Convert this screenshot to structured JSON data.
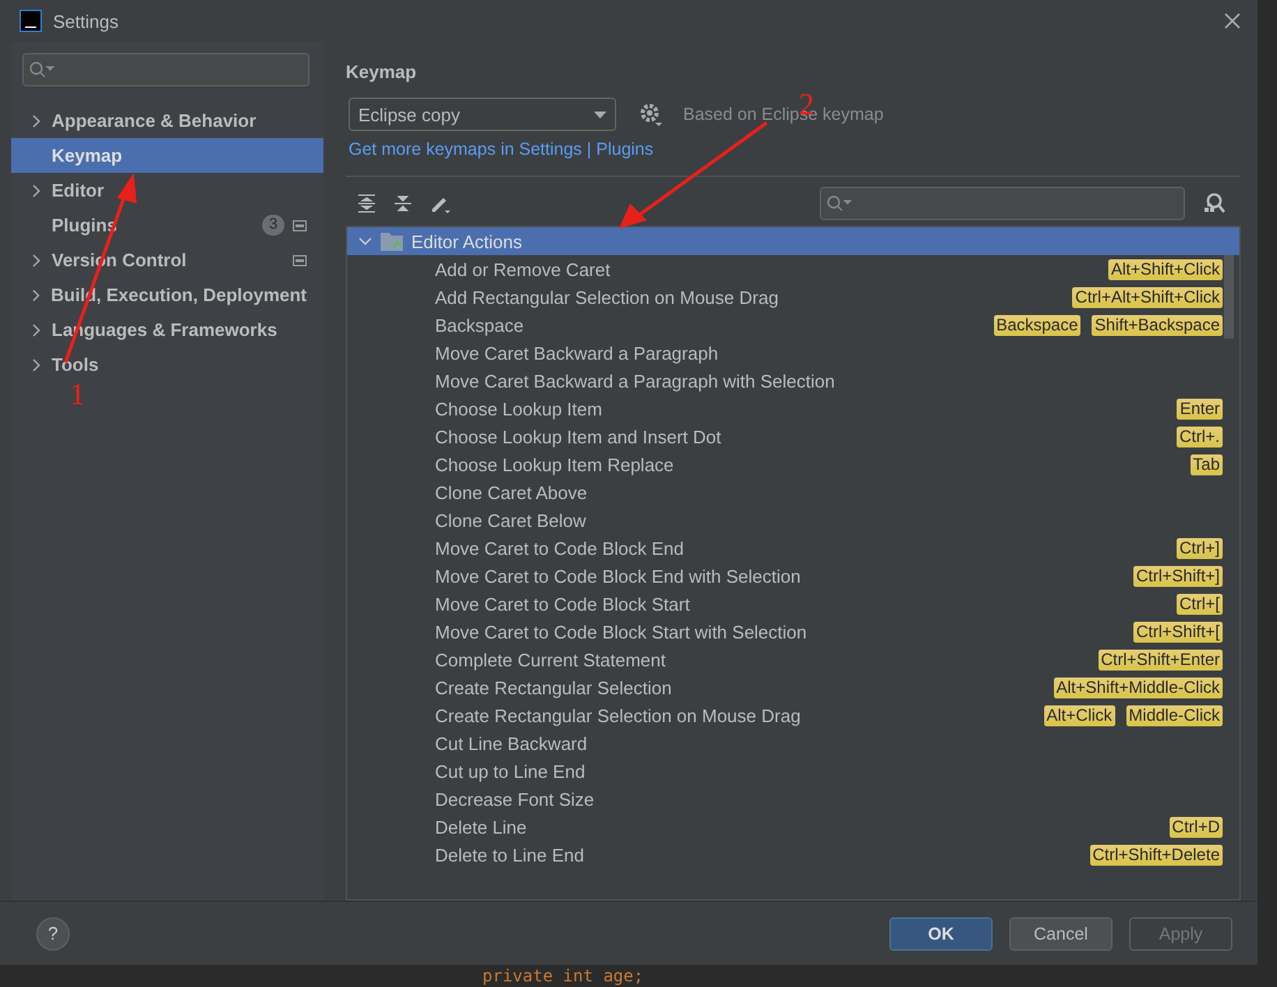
{
  "window": {
    "title": "Settings"
  },
  "sidebar": {
    "items": [
      {
        "label": "Appearance & Behavior",
        "expandable": true,
        "selected": false
      },
      {
        "label": "Keymap",
        "expandable": false,
        "selected": true
      },
      {
        "label": "Editor",
        "expandable": true,
        "selected": false
      },
      {
        "label": "Plugins",
        "expandable": false,
        "selected": false,
        "badge": "3",
        "project_icon": true
      },
      {
        "label": "Version Control",
        "expandable": true,
        "selected": false,
        "project_icon": true
      },
      {
        "label": "Build, Execution, Deployment",
        "expandable": true,
        "selected": false
      },
      {
        "label": "Languages & Frameworks",
        "expandable": true,
        "selected": false
      },
      {
        "label": "Tools",
        "expandable": true,
        "selected": false
      }
    ]
  },
  "panel": {
    "title": "Keymap",
    "keymap": "Eclipse copy",
    "based_on": "Based on Eclipse keymap",
    "link": "Get more keymaps in Settings | Plugins",
    "tree": [
      {
        "label": "Editor Actions",
        "expanded": true,
        "selected": true,
        "children": [
          {
            "label": "Add or Remove Caret",
            "shortcuts": [
              "Alt+Shift+Click"
            ]
          },
          {
            "label": "Add Rectangular Selection on Mouse Drag",
            "shortcuts": [
              "Ctrl+Alt+Shift+Click"
            ]
          },
          {
            "label": "Backspace",
            "shortcuts": [
              "Backspace",
              "Shift+Backspace"
            ]
          },
          {
            "label": "Move Caret Backward a Paragraph"
          },
          {
            "label": "Move Caret Backward a Paragraph with Selection"
          },
          {
            "label": "Choose Lookup Item",
            "shortcuts": [
              "Enter"
            ]
          },
          {
            "label": "Choose Lookup Item and Insert Dot",
            "shortcuts": [
              "Ctrl+."
            ]
          },
          {
            "label": "Choose Lookup Item Replace",
            "shortcuts": [
              "Tab"
            ]
          },
          {
            "label": "Clone Caret Above"
          },
          {
            "label": "Clone Caret Below"
          },
          {
            "label": "Move Caret to Code Block End",
            "shortcuts": [
              "Ctrl+]"
            ]
          },
          {
            "label": "Move Caret to Code Block End with Selection",
            "shortcuts": [
              "Ctrl+Shift+]"
            ]
          },
          {
            "label": "Move Caret to Code Block Start",
            "shortcuts": [
              "Ctrl+["
            ]
          },
          {
            "label": "Move Caret to Code Block Start with Selection",
            "shortcuts": [
              "Ctrl+Shift+["
            ]
          },
          {
            "label": "Complete Current Statement",
            "shortcuts": [
              "Ctrl+Shift+Enter"
            ]
          },
          {
            "label": "Create Rectangular Selection",
            "shortcuts": [
              "Alt+Shift+Middle-Click"
            ]
          },
          {
            "label": "Create Rectangular Selection on Mouse Drag",
            "shortcuts": [
              "Alt+Click",
              "Middle-Click"
            ]
          },
          {
            "label": "Cut Line Backward"
          },
          {
            "label": "Cut up to Line End"
          },
          {
            "label": "Decrease Font Size"
          },
          {
            "label": "Delete Line",
            "shortcuts": [
              "Ctrl+D"
            ]
          },
          {
            "label": "Delete to Line End",
            "shortcuts": [
              "Ctrl+Shift+Delete"
            ]
          }
        ]
      }
    ]
  },
  "annotations": [
    {
      "label": "1"
    },
    {
      "label": "2"
    }
  ],
  "help": {
    "label": "?"
  },
  "buttons": [
    {
      "label": "OK",
      "kind": "primary"
    },
    {
      "label": "Cancel",
      "kind": "normal"
    },
    {
      "label": "Apply",
      "kind": "disabled"
    }
  ],
  "background_code": "private int age;"
}
